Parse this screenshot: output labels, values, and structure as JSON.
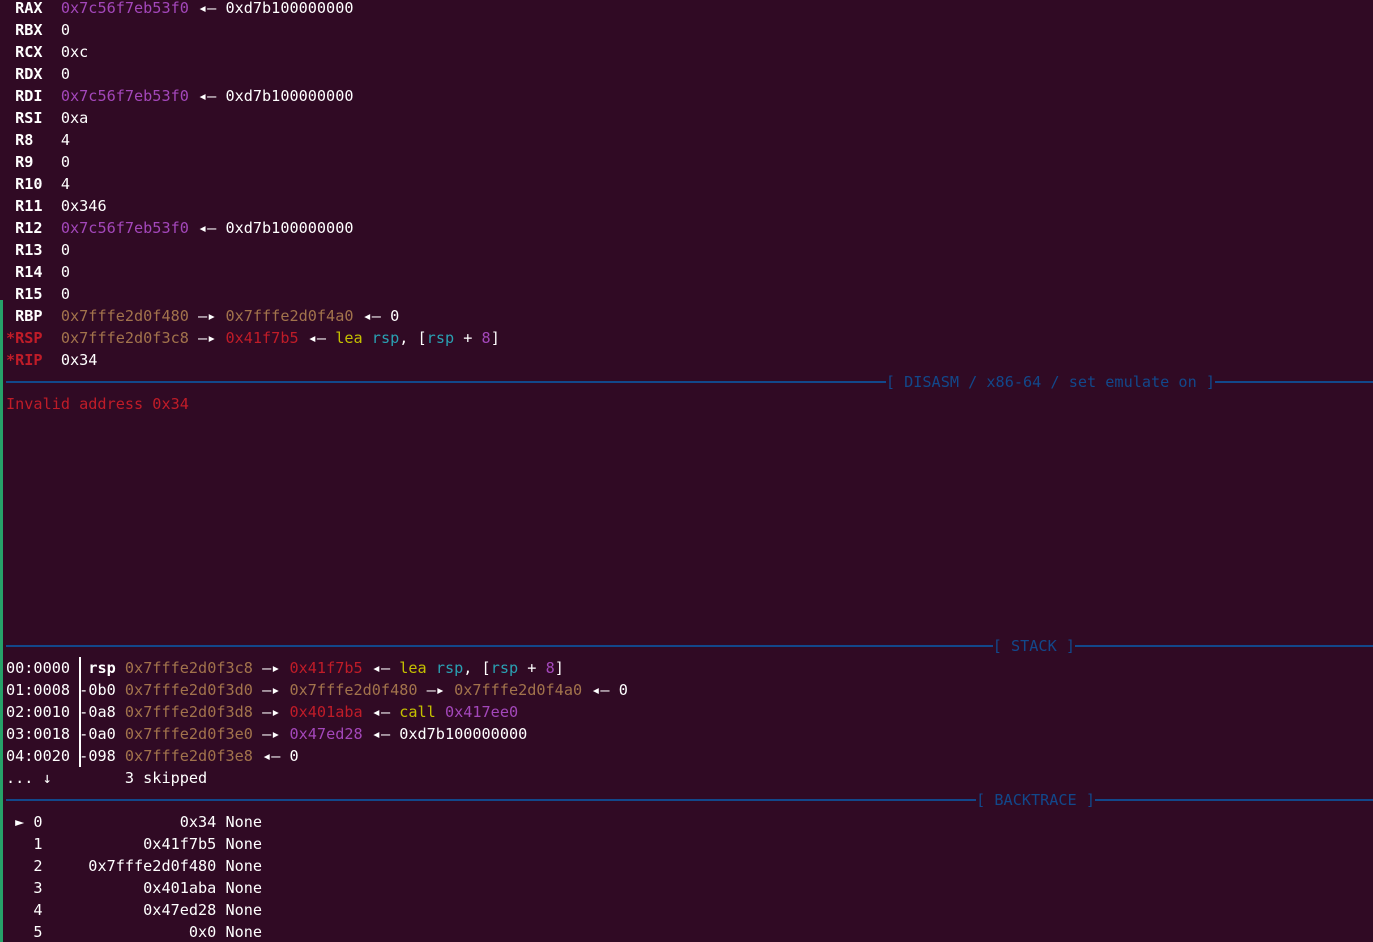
{
  "registers": [
    {
      "name": "RAX",
      "star": "",
      "changed": false,
      "parts": [
        {
          "t": "0x7c56f7eb53f0",
          "c": "heap"
        },
        {
          "t": " ◂— ",
          "c": "arr"
        },
        {
          "t": "0xd7b100000000",
          "c": "val"
        }
      ]
    },
    {
      "name": "RBX",
      "star": "",
      "changed": false,
      "parts": [
        {
          "t": "0",
          "c": "val"
        }
      ]
    },
    {
      "name": "RCX",
      "star": "",
      "changed": false,
      "parts": [
        {
          "t": "0xc",
          "c": "val"
        }
      ]
    },
    {
      "name": "RDX",
      "star": "",
      "changed": false,
      "parts": [
        {
          "t": "0",
          "c": "val"
        }
      ]
    },
    {
      "name": "RDI",
      "star": "",
      "changed": false,
      "parts": [
        {
          "t": "0x7c56f7eb53f0",
          "c": "heap"
        },
        {
          "t": " ◂— ",
          "c": "arr"
        },
        {
          "t": "0xd7b100000000",
          "c": "val"
        }
      ]
    },
    {
      "name": "RSI",
      "star": "",
      "changed": false,
      "parts": [
        {
          "t": "0xa",
          "c": "val"
        }
      ]
    },
    {
      "name": "R8",
      "star": "",
      "changed": false,
      "parts": [
        {
          "t": "4",
          "c": "val"
        }
      ]
    },
    {
      "name": "R9",
      "star": "",
      "changed": false,
      "parts": [
        {
          "t": "0",
          "c": "val"
        }
      ]
    },
    {
      "name": "R10",
      "star": "",
      "changed": false,
      "parts": [
        {
          "t": "4",
          "c": "val"
        }
      ]
    },
    {
      "name": "R11",
      "star": "",
      "changed": false,
      "parts": [
        {
          "t": "0x346",
          "c": "val"
        }
      ]
    },
    {
      "name": "R12",
      "star": "",
      "changed": false,
      "parts": [
        {
          "t": "0x7c56f7eb53f0",
          "c": "heap"
        },
        {
          "t": " ◂— ",
          "c": "arr"
        },
        {
          "t": "0xd7b100000000",
          "c": "val"
        }
      ]
    },
    {
      "name": "R13",
      "star": "",
      "changed": false,
      "parts": [
        {
          "t": "0",
          "c": "val"
        }
      ]
    },
    {
      "name": "R14",
      "star": "",
      "changed": false,
      "parts": [
        {
          "t": "0",
          "c": "val"
        }
      ]
    },
    {
      "name": "R15",
      "star": "",
      "changed": false,
      "parts": [
        {
          "t": "0",
          "c": "val"
        }
      ]
    },
    {
      "name": "RBP",
      "star": "",
      "changed": false,
      "parts": [
        {
          "t": "0x7fffe2d0f480",
          "c": "stk"
        },
        {
          "t": " —▸ ",
          "c": "arr"
        },
        {
          "t": "0x7fffe2d0f4a0",
          "c": "stk"
        },
        {
          "t": " ◂— ",
          "c": "arr"
        },
        {
          "t": "0",
          "c": "val"
        }
      ]
    },
    {
      "name": "RSP",
      "star": "*",
      "changed": true,
      "parts": [
        {
          "t": "0x7fffe2d0f3c8",
          "c": "stk"
        },
        {
          "t": " —▸ ",
          "c": "arr"
        },
        {
          "t": "0x41f7b5",
          "c": "code"
        },
        {
          "t": " ◂— ",
          "c": "arr"
        },
        {
          "t": "lea",
          "c": "mn"
        },
        {
          "t": " ",
          "c": "val"
        },
        {
          "t": "rsp",
          "c": "rg"
        },
        {
          "t": ", [",
          "c": "val"
        },
        {
          "t": "rsp",
          "c": "rg"
        },
        {
          "t": " + ",
          "c": "val"
        },
        {
          "t": "8",
          "c": "nm"
        },
        {
          "t": "]",
          "c": "val"
        }
      ]
    },
    {
      "name": "RIP",
      "star": "*",
      "changed": true,
      "parts": [
        {
          "t": "0x34",
          "c": "val"
        }
      ]
    }
  ],
  "sections": {
    "disasm": "[ DISASM / x86-64 / set emulate on ]",
    "stack": "[ STACK ]",
    "backtrace": "[ BACKTRACE ]"
  },
  "disasm_error": "Invalid address 0x34",
  "stack": [
    {
      "idx": "00:0000",
      "off": " rsp",
      "offBold": true,
      "parts": [
        {
          "t": "0x7fffe2d0f3c8",
          "c": "stk"
        },
        {
          "t": " —▸ ",
          "c": "arr"
        },
        {
          "t": "0x41f7b5",
          "c": "code"
        },
        {
          "t": " ◂— ",
          "c": "arr"
        },
        {
          "t": "lea",
          "c": "mn"
        },
        {
          "t": " ",
          "c": "val"
        },
        {
          "t": "rsp",
          "c": "rg"
        },
        {
          "t": ", [",
          "c": "val"
        },
        {
          "t": "rsp",
          "c": "rg"
        },
        {
          "t": " + ",
          "c": "val"
        },
        {
          "t": "8",
          "c": "nm"
        },
        {
          "t": "]",
          "c": "val"
        }
      ]
    },
    {
      "idx": "01:0008",
      "off": "-0b0",
      "offBold": false,
      "parts": [
        {
          "t": "0x7fffe2d0f3d0",
          "c": "stk"
        },
        {
          "t": " —▸ ",
          "c": "arr"
        },
        {
          "t": "0x7fffe2d0f480",
          "c": "stk"
        },
        {
          "t": " —▸ ",
          "c": "arr"
        },
        {
          "t": "0x7fffe2d0f4a0",
          "c": "stk"
        },
        {
          "t": " ◂— ",
          "c": "arr"
        },
        {
          "t": "0",
          "c": "val"
        }
      ]
    },
    {
      "idx": "02:0010",
      "off": "-0a8",
      "offBold": false,
      "parts": [
        {
          "t": "0x7fffe2d0f3d8",
          "c": "stk"
        },
        {
          "t": " —▸ ",
          "c": "arr"
        },
        {
          "t": "0x401aba",
          "c": "code"
        },
        {
          "t": " ◂— ",
          "c": "arr"
        },
        {
          "t": "call",
          "c": "mn"
        },
        {
          "t": " ",
          "c": "val"
        },
        {
          "t": "0x417ee0",
          "c": "dat"
        }
      ]
    },
    {
      "idx": "03:0018",
      "off": "-0a0",
      "offBold": false,
      "parts": [
        {
          "t": "0x7fffe2d0f3e0",
          "c": "stk"
        },
        {
          "t": " —▸ ",
          "c": "arr"
        },
        {
          "t": "0x47ed28",
          "c": "dat"
        },
        {
          "t": " ◂— ",
          "c": "arr"
        },
        {
          "t": "0xd7b100000000",
          "c": "val"
        }
      ]
    },
    {
      "idx": "04:0020",
      "off": "-098",
      "offBold": false,
      "parts": [
        {
          "t": "0x7fffe2d0f3e8",
          "c": "stk"
        },
        {
          "t": " ◂— ",
          "c": "arr"
        },
        {
          "t": "0",
          "c": "val"
        }
      ]
    }
  ],
  "stack_skipped": "... ↓        3 skipped",
  "backtrace": [
    {
      "marker": "►",
      "num": "0",
      "addr": "0x34",
      "name": "None"
    },
    {
      "marker": "",
      "num": "1",
      "addr": "0x41f7b5",
      "name": "None"
    },
    {
      "marker": "",
      "num": "2",
      "addr": "0x7fffe2d0f480",
      "name": "None"
    },
    {
      "marker": "",
      "num": "3",
      "addr": "0x401aba",
      "name": "None"
    },
    {
      "marker": "",
      "num": "4",
      "addr": "0x47ed28",
      "name": "None"
    },
    {
      "marker": "",
      "num": "5",
      "addr": "0x0",
      "name": "None"
    }
  ]
}
